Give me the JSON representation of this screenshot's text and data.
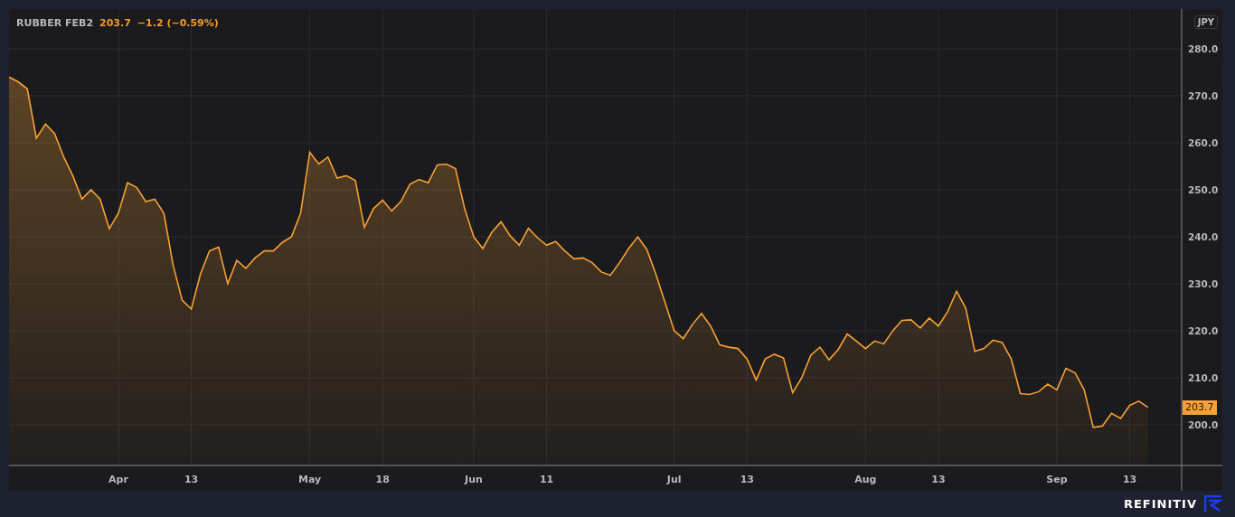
{
  "legend": {
    "last": "203.7",
    "change": "−1.2 (−0.59%)"
  },
  "currency": "JPY",
  "price_tag": "203.7",
  "brand": "REFINITIV",
  "chart_data": {
    "type": "area",
    "grid": true,
    "categories": [
      null,
      null,
      null,
      null,
      null,
      null,
      null,
      null,
      null,
      null,
      null,
      null,
      "Apr",
      null,
      null,
      null,
      null,
      null,
      null,
      null,
      "13",
      null,
      null,
      null,
      null,
      null,
      null,
      null,
      null,
      null,
      null,
      null,
      null,
      "May",
      null,
      null,
      null,
      null,
      null,
      null,
      null,
      "18",
      null,
      null,
      null,
      null,
      null,
      null,
      null,
      null,
      null,
      "Jun",
      null,
      null,
      null,
      null,
      null,
      null,
      null,
      "11",
      null,
      null,
      null,
      null,
      null,
      null,
      null,
      null,
      null,
      null,
      null,
      null,
      null,
      "Jul",
      null,
      null,
      null,
      null,
      null,
      null,
      null,
      "13",
      null,
      null,
      null,
      null,
      null,
      null,
      null,
      null,
      null,
      null,
      null,
      null,
      "Aug",
      null,
      null,
      null,
      null,
      null,
      null,
      null,
      "13",
      null,
      null,
      null,
      null,
      null,
      null,
      null,
      null,
      null,
      null,
      null,
      null,
      "Sep",
      null,
      null,
      null,
      null,
      null,
      null,
      null,
      "13",
      null,
      null
    ],
    "series": [
      {
        "name": "RUBBER FEB2",
        "color": "#f7a035",
        "values": [
          274,
          273,
          271.5,
          261,
          264,
          262,
          257,
          253,
          248,
          250,
          248,
          241.7,
          245,
          251.5,
          250.5,
          247.5,
          248,
          245,
          234,
          226.5,
          224.6,
          232,
          237,
          237.8,
          230,
          235,
          233.3,
          235.5,
          237,
          237,
          238.8,
          240,
          245,
          258,
          255.5,
          257,
          252.5,
          253,
          252,
          242,
          246,
          247.8,
          245.5,
          247.5,
          251.2,
          252.2,
          251.5,
          255.3,
          255.5,
          254.5,
          246,
          240,
          237.5,
          241,
          243.2,
          240.2,
          238.2,
          241.8,
          239.8,
          238.2,
          239,
          237,
          235.3,
          235.5,
          234.5,
          232.5,
          231.8,
          234.5,
          237.5,
          240,
          237.3,
          232,
          226,
          220,
          218.3,
          221.3,
          223.7,
          221,
          217,
          216.5,
          216.2,
          214,
          209.5,
          214,
          215,
          214.2,
          206.8,
          210,
          214.8,
          216.5,
          213.8,
          216,
          219.3,
          217.8,
          216.2,
          217.8,
          217.2,
          220,
          222.2,
          222.3,
          220.6,
          222.7,
          221,
          224,
          228.4,
          224.8,
          215.6,
          216.2,
          218,
          217.5,
          214,
          206.6,
          206.4,
          207,
          208.6,
          207.4,
          212,
          211,
          207.4,
          199.4,
          199.7,
          202.4,
          201.3,
          204.1,
          205,
          203.7
        ]
      }
    ],
    "ylim": [
      191.3,
      288.5
    ],
    "yticks": [
      {
        "value": 200,
        "label": "200.0"
      },
      {
        "value": 210,
        "label": "210.0"
      },
      {
        "value": 220,
        "label": "220.0"
      },
      {
        "value": 230,
        "label": "230.0"
      },
      {
        "value": 240,
        "label": "240.0"
      },
      {
        "value": 250,
        "label": "250.0"
      },
      {
        "value": 260,
        "label": "260.0"
      },
      {
        "value": 270,
        "label": "270.0"
      },
      {
        "value": 280,
        "label": "280.0"
      }
    ]
  }
}
